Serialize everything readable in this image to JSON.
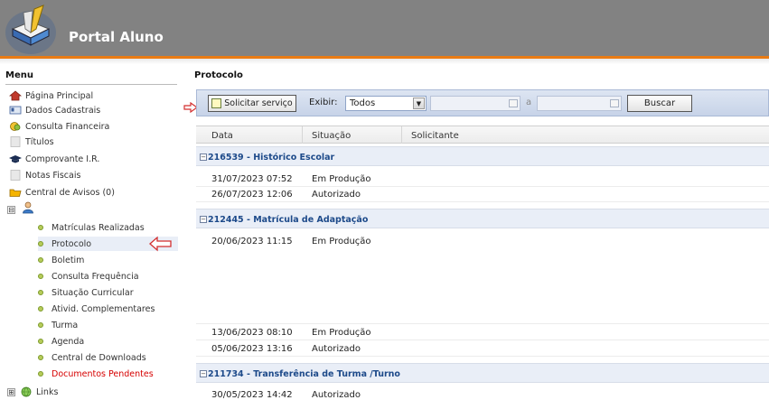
{
  "header": {
    "title": "Portal Aluno"
  },
  "sidebar": {
    "title": "Menu",
    "items": [
      {
        "label": "Página Principal",
        "icon": "home-icon"
      },
      {
        "label": "Dados Cadastrais",
        "icon": "id-card-icon"
      },
      {
        "label": "Consulta Financeira",
        "icon": "coins-icon"
      },
      {
        "label": "Títulos",
        "icon": "document-icon"
      },
      {
        "label": "Comprovante I.R.",
        "icon": "graduation-cap-icon"
      },
      {
        "label": "Notas Fiscais",
        "icon": "document-icon"
      },
      {
        "label": "Central de Avisos (0)",
        "icon": "folder-icon"
      }
    ],
    "group_toggle": "⊟",
    "sub_items": [
      {
        "label": "Matrículas Realizadas"
      },
      {
        "label": "Protocolo"
      },
      {
        "label": "Boletim"
      },
      {
        "label": "Consulta Frequência"
      },
      {
        "label": "Situação Curricular"
      },
      {
        "label": "Ativid. Complementares"
      },
      {
        "label": "Turma"
      },
      {
        "label": "Agenda"
      },
      {
        "label": "Central de Downloads"
      },
      {
        "label": "Documentos Pendentes"
      }
    ],
    "links_label": "Links",
    "links_toggle": "⊞"
  },
  "main": {
    "title": "Protocolo",
    "toolbar": {
      "solicitar_label": "Solicitar serviço",
      "exibir_label": "Exibir:",
      "exibir_value": "Todos",
      "a_label": "a",
      "buscar_label": "Buscar"
    },
    "columns": [
      "Data",
      "Situação",
      "Solicitante"
    ],
    "groups": [
      {
        "label": "216539 - Histórico Escolar",
        "rows": [
          {
            "data": "31/07/2023 07:52",
            "situacao": "Em Produção"
          },
          {
            "data": "26/07/2023 12:06",
            "situacao": "Autorizado"
          }
        ]
      },
      {
        "label": "212445 - Matrícula de Adaptação",
        "rows": [
          {
            "data": "20/06/2023 11:15",
            "situacao": "Em Produção"
          },
          {
            "data": "13/06/2023 08:10",
            "situacao": "Em Produção"
          },
          {
            "data": "05/06/2023 13:16",
            "situacao": "Autorizado"
          }
        ]
      },
      {
        "label": "211734 - Transferência de Turma /Turno",
        "rows": [
          {
            "data": "30/05/2023 14:42",
            "situacao": "Autorizado"
          }
        ]
      }
    ]
  },
  "colors": {
    "header_bg": "#828282",
    "header_accent": "#e97b14",
    "group_text": "#1d4a8a",
    "danger": "#d60000",
    "arrow": "#d32f2f"
  }
}
